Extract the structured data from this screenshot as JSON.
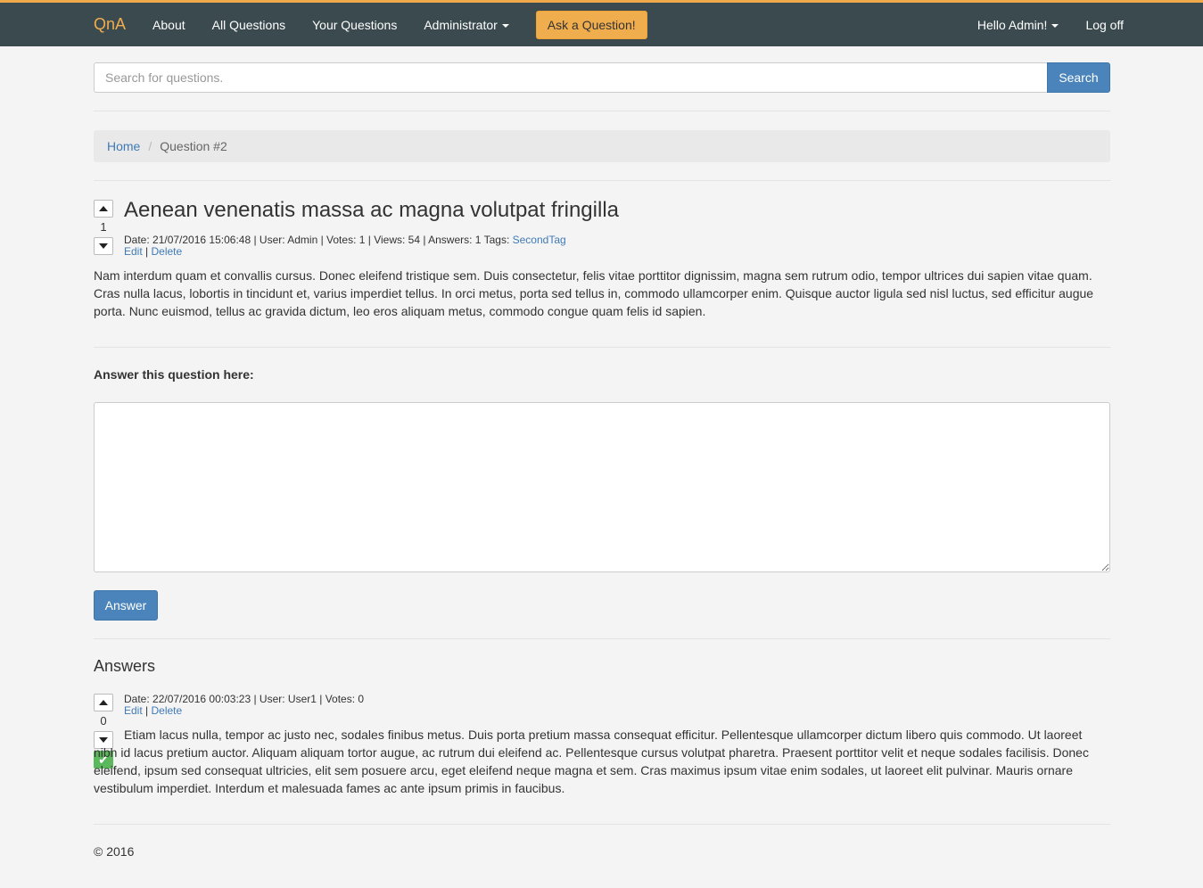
{
  "nav": {
    "brand": "QnA",
    "links": [
      "About",
      "All Questions",
      "Your Questions",
      "Administrator"
    ],
    "ask_button": "Ask a Question!",
    "user_menu": "Hello Admin!",
    "logoff": "Log off"
  },
  "search": {
    "placeholder": "Search for questions.",
    "button": "Search"
  },
  "breadcrumb": {
    "home": "Home",
    "separator": "/",
    "current": "Question #2"
  },
  "question": {
    "votes": "1",
    "title": "Aenean venenatis massa ac magna volutpat fringilla",
    "meta": "Date: 21/07/2016 15:06:48 | User: Admin | Votes: 1 | Views: 54 | Answers: 1 Tags: ",
    "tag": "SecondTag",
    "edit": "Edit",
    "divider": "|",
    "delete": "Delete",
    "body": "Nam interdum quam et convallis cursus. Donec eleifend tristique sem. Duis consectetur, felis vitae porttitor dignissim, magna sem rutrum odio, tempor ultrices dui sapien vitae quam. Cras nulla lacus, lobortis in tincidunt et, varius imperdiet tellus. In orci metus, porta sed tellus in, commodo ullamcorper enim. Quisque auctor ligula sed nisl luctus, sed efficitur augue porta. Nunc euismod, tellus ac gravida dictum, leo eros aliquam metus, commodo congue quam felis id sapien."
  },
  "answer_form": {
    "label": "Answer this question here:",
    "button": "Answer"
  },
  "answers": {
    "title": "Answers",
    "items": [
      {
        "votes": "0",
        "meta": "Date: 22/07/2016 00:03:23 | User: User1 | Votes: 0",
        "edit": "Edit",
        "divider": "|",
        "delete": "Delete",
        "body": "Etiam lacus nulla, tempor ac justo nec, sodales finibus metus. Duis porta pretium massa consequat efficitur. Pellentesque ullamcorper dictum libero quis commodo. Ut laoreet nibh id lacus pretium auctor. Aliquam aliquam tortor augue, ac rutrum dui eleifend ac. Pellentesque cursus volutpat pharetra. Praesent porttitor velit et neque sodales facilisis. Donec eleifend, ipsum sed consequat ultricies, elit sem posuere arcu, eget eleifend neque magna et sem. Cras maximus ipsum vitae enim sodales, ut laoreet elit pulvinar. Mauris ornare vestibulum imperdiet. Interdum et malesuada fames ac ante ipsum primis in faucibus."
      }
    ]
  },
  "footer": "© 2016",
  "colors": {
    "navbar": "#3a4a4f",
    "accent": "#f0ad4e",
    "primary": "#4a84bb",
    "link": "#3f7ab6",
    "success": "#5cb85c"
  }
}
